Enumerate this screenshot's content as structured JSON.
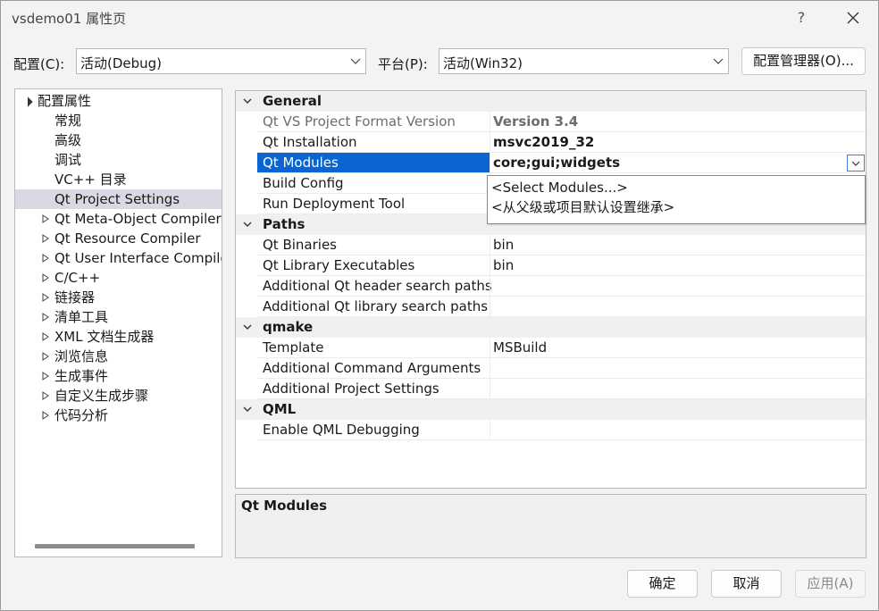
{
  "window": {
    "title": "vsdemo01 属性页",
    "help_label": "?"
  },
  "config": {
    "configuration_label": "配置(C):",
    "configuration_value": "活动(Debug)",
    "platform_label": "平台(P):",
    "platform_value": "活动(Win32)",
    "manager_button": "配置管理器(O)..."
  },
  "tree": {
    "root": "配置属性",
    "children": [
      "常规",
      "高级",
      "调试",
      "VC++ 目录",
      "Qt Project Settings"
    ],
    "collapsed": [
      "Qt Meta-Object Compiler",
      "Qt Resource Compiler",
      "Qt User Interface Compiler",
      "C/C++",
      "链接器",
      "清单工具",
      "XML 文档生成器",
      "浏览信息",
      "生成事件",
      "自定义生成步骤",
      "代码分析"
    ],
    "selected": "Qt Project Settings"
  },
  "grid": {
    "general": {
      "name": "General",
      "rows": [
        {
          "name": "Qt VS Project Format Version",
          "value": "Version 3.4"
        },
        {
          "name": "Qt Installation",
          "value": "msvc2019_32"
        },
        {
          "name": "Qt Modules",
          "value": "core;gui;widgets"
        },
        {
          "name": "Build Config",
          "value": ""
        },
        {
          "name": "Run Deployment Tool",
          "value": ""
        }
      ]
    },
    "paths": {
      "name": "Paths",
      "rows": [
        {
          "name": "Qt Binaries",
          "value": "bin"
        },
        {
          "name": "Qt Library Executables",
          "value": "bin"
        },
        {
          "name": "Additional Qt header search paths",
          "value": ""
        },
        {
          "name": "Additional Qt library search paths",
          "value": ""
        }
      ]
    },
    "qmake": {
      "name": "qmake",
      "rows": [
        {
          "name": "Template",
          "value": "MSBuild"
        },
        {
          "name": "Additional Command Arguments",
          "value": ""
        },
        {
          "name": "Additional Project Settings",
          "value": ""
        }
      ]
    },
    "qml": {
      "name": "QML",
      "rows": [
        {
          "name": "Enable QML Debugging",
          "value": ""
        }
      ]
    }
  },
  "dropdown": {
    "options": [
      "<Select Modules...>",
      "<从父级或项目默认设置继承>"
    ]
  },
  "description": {
    "title": "Qt Modules"
  },
  "buttons": {
    "ok": "确定",
    "cancel": "取消",
    "apply": "应用(A)"
  },
  "colors": {
    "selection": "#0a64d2",
    "tree_selection": "#d9d9e3",
    "category_bg": "#f0f0f0"
  }
}
